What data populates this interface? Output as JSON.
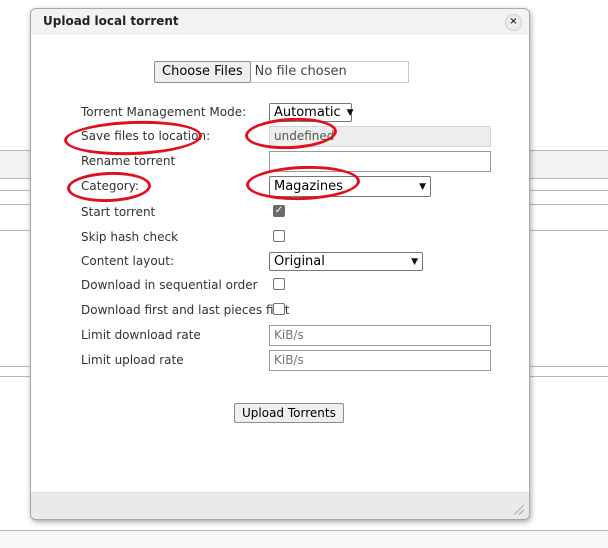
{
  "dialog": {
    "title": "Upload local torrent",
    "close_label": "×"
  },
  "file_picker": {
    "button_label": "Choose Files",
    "status": "No file chosen"
  },
  "form": {
    "rows": [
      {
        "label": "Torrent Management Mode:",
        "type": "select",
        "value": "Automatic"
      },
      {
        "label": "Save files to location:",
        "type": "text",
        "value": "undefined",
        "disabled": true
      },
      {
        "label": "Rename torrent",
        "type": "text",
        "value": ""
      },
      {
        "label": "Category:",
        "type": "select",
        "value": "Magazines"
      },
      {
        "label": "Start torrent",
        "type": "checkbox",
        "checked": true
      },
      {
        "label": "Skip hash check",
        "type": "checkbox",
        "checked": false
      },
      {
        "label": "Content layout:",
        "type": "select",
        "value": "Original"
      },
      {
        "label": "Download in sequential order",
        "type": "checkbox",
        "checked": false
      },
      {
        "label": "Download first and last pieces first",
        "type": "checkbox",
        "checked": false
      },
      {
        "label": "Limit download rate",
        "type": "text",
        "placeholder": "KiB/s"
      },
      {
        "label": "Limit upload rate",
        "type": "text",
        "placeholder": "KiB/s"
      }
    ]
  },
  "upload_button_label": "Upload Torrents",
  "annotation_color": "#e0101e"
}
